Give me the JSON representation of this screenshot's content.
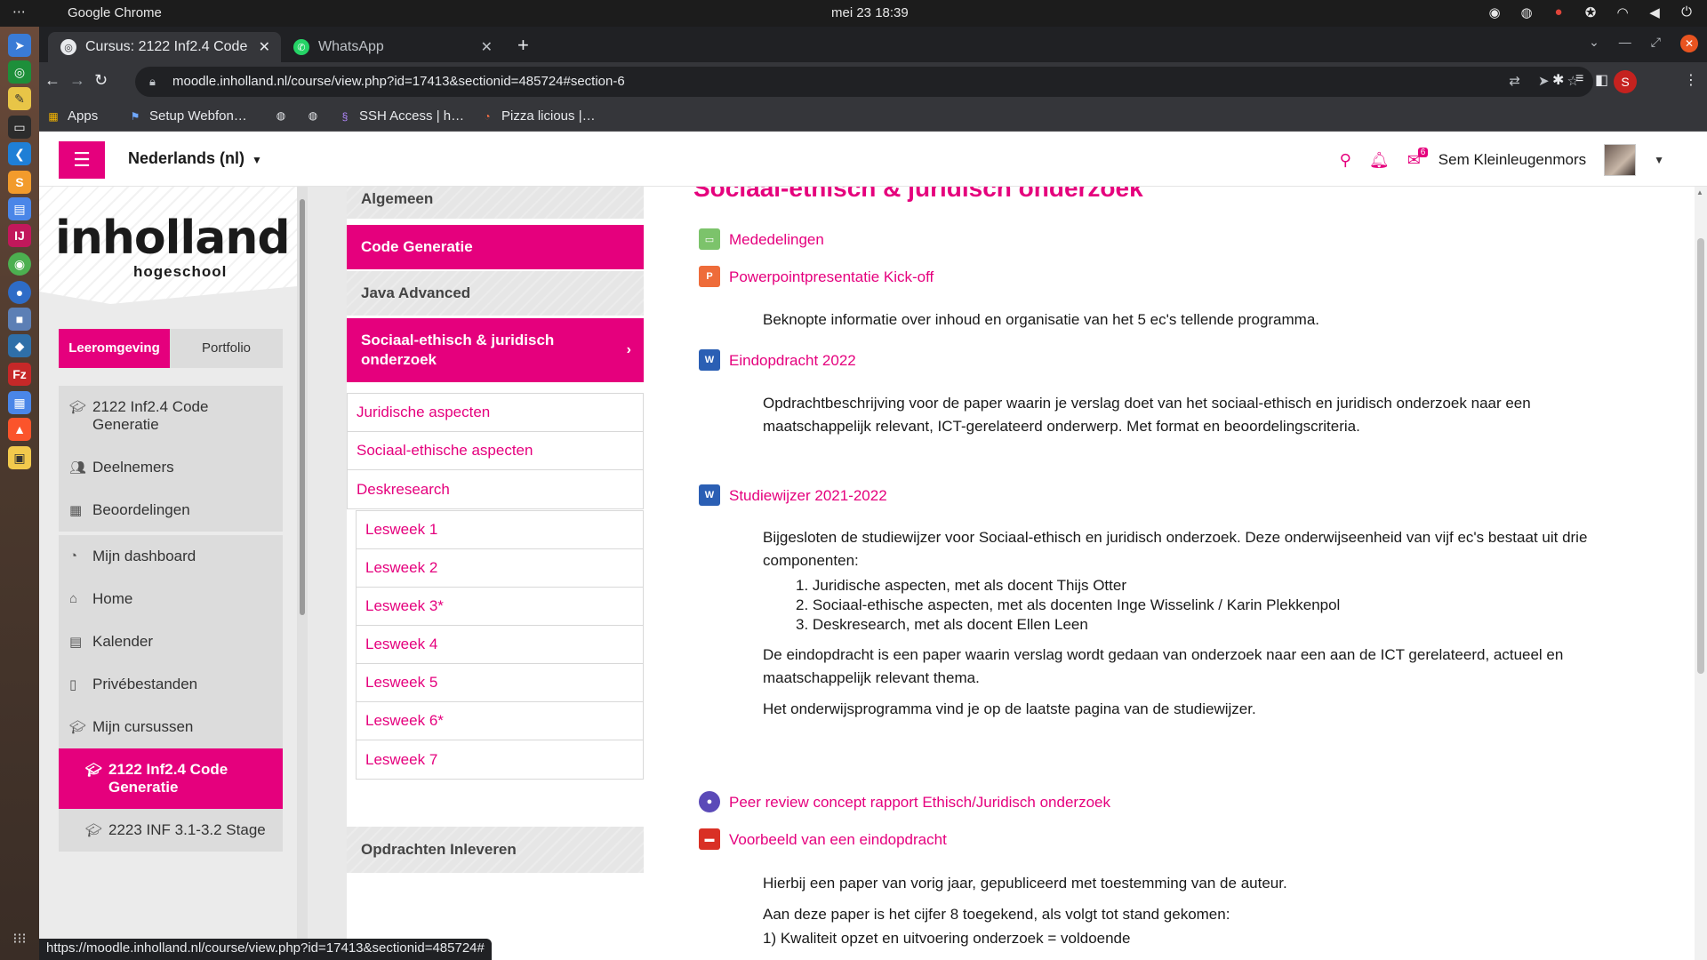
{
  "os_bar": {
    "app_name": "Google Chrome",
    "clock": "mei 23  18:39"
  },
  "dock": {
    "apps": [
      "Remmina",
      "Vim",
      "Text Editor",
      "Terminal",
      "VS Code",
      "Sublime Text",
      "Document",
      "IntelliJ IDEA",
      "Chrome",
      "Firefox",
      "App",
      "App",
      "FileZilla",
      "App",
      "Brave",
      "App"
    ]
  },
  "browser": {
    "tabs": [
      {
        "label": "Cursus: 2122 Inf2.4 Code",
        "active": true
      },
      {
        "label": "WhatsApp",
        "active": false
      }
    ],
    "url": "moodle.inholland.nl/course/view.php?id=17413&sectionid=485724#section-6",
    "profile_initial": "S",
    "bookmarks": [
      {
        "label": "Apps"
      },
      {
        "label": "Setup Webfon…"
      },
      {
        "label": ""
      },
      {
        "label": ""
      },
      {
        "label": "SSH Access | h…"
      },
      {
        "label": "Pizza licious |…"
      }
    ],
    "status_url": "https://moodle.inholland.nl/course/view.php?id=17413&sectionid=485724#"
  },
  "navbar": {
    "language": "Nederlands (nl)",
    "message_count": "6",
    "user_name": "Sem Kleinleugenmors"
  },
  "brand": {
    "logo_main": "inholland",
    "logo_sub": "hogeschool",
    "accent_color": "#e5007d"
  },
  "drawer": {
    "tabs": [
      "Leeromgeving",
      "Portfolio"
    ],
    "course_group": [
      {
        "label": "2122 Inf2.4 Code Generatie",
        "icon": "graduation-cap-icon"
      },
      {
        "label": "Deelnemers",
        "icon": "users-icon"
      },
      {
        "label": "Beoordelingen",
        "icon": "table-icon"
      }
    ],
    "site_group": [
      {
        "label": "Mijn dashboard",
        "icon": "dashboard-icon"
      },
      {
        "label": "Home",
        "icon": "home-icon"
      },
      {
        "label": "Kalender",
        "icon": "calendar-icon"
      },
      {
        "label": "Privébestanden",
        "icon": "file-icon"
      },
      {
        "label": "Mijn cursussen",
        "icon": "graduation-cap-icon"
      },
      {
        "label": "2122 Inf2.4 Code Generatie",
        "icon": "graduation-cap-icon",
        "active": true
      },
      {
        "label": "2223 INF 3.1-3.2 Stage",
        "icon": "graduation-cap-icon"
      }
    ]
  },
  "section_nav": {
    "sections": [
      {
        "label": "Algemeen"
      },
      {
        "label": "Code Generatie"
      },
      {
        "label": "Java Advanced"
      },
      {
        "label": "Sociaal-ethisch & juridisch onderzoek"
      },
      {
        "label": "Opdrachten Inleveren"
      }
    ],
    "topics": [
      "Juridische aspecten",
      "Sociaal-ethische aspecten",
      "Deskresearch"
    ],
    "weeks": [
      "Lesweek 1",
      "Lesweek 2",
      "Lesweek 3*",
      "Lesweek 4",
      "Lesweek 5",
      "Lesweek 6*",
      "Lesweek 7"
    ]
  },
  "content": {
    "section_title": "Sociaal-ethisch & juridisch onderzoek",
    "activities": [
      {
        "label": "Mededelingen",
        "icon": "forum-icon"
      },
      {
        "label": "Powerpointpresentatie Kick-off",
        "icon": "powerpoint-icon"
      },
      {
        "label": "Eindopdracht 2022",
        "icon": "word-icon"
      },
      {
        "label": "Studiewijzer 2021-2022",
        "icon": "word-icon"
      },
      {
        "label": "Peer review concept rapport Ethisch/Juridisch onderzoek",
        "icon": "workshop-icon"
      },
      {
        "label": "Voorbeeld van een eindopdracht",
        "icon": "pdf-icon"
      }
    ],
    "kickoff_desc": "Beknopte informatie over inhoud en organisatie van het 5 ec's tellende programma.",
    "eindopdracht_desc": "Opdrachtbeschrijving voor de paper waarin je verslag doet van het sociaal-ethisch en juridisch onderzoek naar een maatschappelijk relevant, ICT-gerelateerd onderwerp.  Met format en beoordelingscriteria.",
    "studiewijzer_intro": "Bijgesloten de studiewijzer voor Sociaal-ethisch en juridisch onderzoek. Deze onderwijseenheid van vijf ec's bestaat uit drie componenten:",
    "components": [
      "1. Juridische aspecten, met als docent Thijs Otter",
      "2. Sociaal-ethische aspecten, met als docenten Inge Wisselink / Karin Plekkenpol",
      "3. Deskresearch, met als docent Ellen Leen"
    ],
    "studiewijzer_p2": "De eindopdracht is een paper waarin verslag wordt gedaan van onderzoek naar een aan de ICT gerelateerd, actueel en maatschappelijk relevant thema.",
    "studiewijzer_p3": "Het onderwijsprogramma vind je op de laatste pagina van de studiewijzer.",
    "voorbeeld_p1": "Hierbij een paper van vorig jaar, gepubliceerd met toestemming van de auteur.",
    "voorbeeld_p2": "Aan deze paper is het cijfer 8 toegekend, als volgt tot stand gekomen:",
    "voorbeeld_p3": "1) Kwaliteit opzet en uitvoering onderzoek = voldoende"
  }
}
